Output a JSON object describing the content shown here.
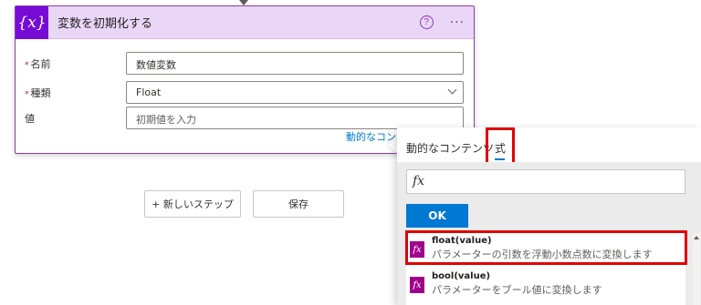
{
  "card": {
    "icon_text": "{x}",
    "title": "変数を初期化する",
    "help_glyph": "?",
    "more_glyph": "···",
    "required_mark": "*",
    "fields": {
      "name_label": "名前",
      "name_value": "数値変数",
      "type_label": "種類",
      "type_value": "Float",
      "value_label": "値",
      "value_placeholder": "初期値を入力"
    },
    "dynamic_link": "動的なコンテンツの追加"
  },
  "actions": {
    "new_step": "+ 新しいステップ",
    "save": "保存"
  },
  "flyout": {
    "tabs": [
      "動的なコンテンツ",
      "式"
    ],
    "expression_placeholder": "fx",
    "ok_label": "OK",
    "functions": [
      {
        "name": "float(value)",
        "desc": "パラメーターの引数を浮動小数点数に変換します"
      },
      {
        "name": "bool(value)",
        "desc": "パラメーターをブール値に変換します"
      }
    ],
    "fn_icon": "fx"
  },
  "colors": {
    "accent_purple": "#770bd6",
    "header_bg": "#ead6f7",
    "primary_blue": "#0078d4",
    "highlight_red": "#e00000",
    "fn_icon_bg": "#a1008b"
  }
}
